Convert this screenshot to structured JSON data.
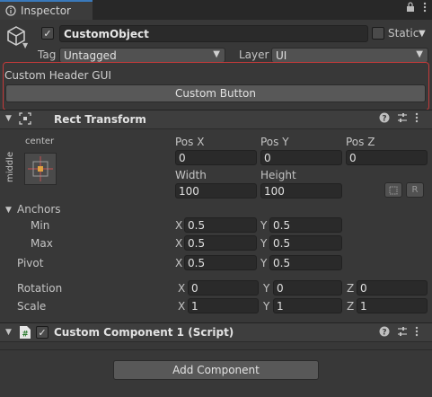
{
  "tab": {
    "title": "Inspector",
    "icon": "info-icon"
  },
  "object": {
    "name": "CustomObject",
    "active": true,
    "static_label": "Static",
    "tag_label": "Tag",
    "tag_value": "Untagged",
    "layer_label": "Layer",
    "layer_value": "UI"
  },
  "custom_header": {
    "title": "Custom Header GUI",
    "button_label": "Custom Button",
    "border_color": "#c23a3a"
  },
  "rect_transform": {
    "title": "Rect Transform",
    "anchor_preset": {
      "horizontal": "center",
      "vertical": "middle"
    },
    "pos_x_label": "Pos X",
    "pos_y_label": "Pos Y",
    "pos_z_label": "Pos Z",
    "pos_x": "0",
    "pos_y": "0",
    "pos_z": "0",
    "width_label": "Width",
    "height_label": "Height",
    "width": "100",
    "height": "100",
    "raw_button": "R",
    "anchors_label": "Anchors",
    "min_label": "Min",
    "max_label": "Max",
    "min_x": "0.5",
    "min_y": "0.5",
    "max_x": "0.5",
    "max_y": "0.5",
    "pivot_label": "Pivot",
    "pivot_x": "0.5",
    "pivot_y": "0.5",
    "rotation_label": "Rotation",
    "rot_x": "0",
    "rot_y": "0",
    "rot_z": "0",
    "scale_label": "Scale",
    "scale_x": "1",
    "scale_y": "1",
    "scale_z": "1",
    "axis_x": "X",
    "axis_y": "Y",
    "axis_z": "Z"
  },
  "script_component": {
    "title": "Custom Component 1 (Script)",
    "enabled": true
  },
  "add_component_label": "Add Component",
  "colors": {
    "accent": "#3a79bb",
    "background": "#383838"
  }
}
